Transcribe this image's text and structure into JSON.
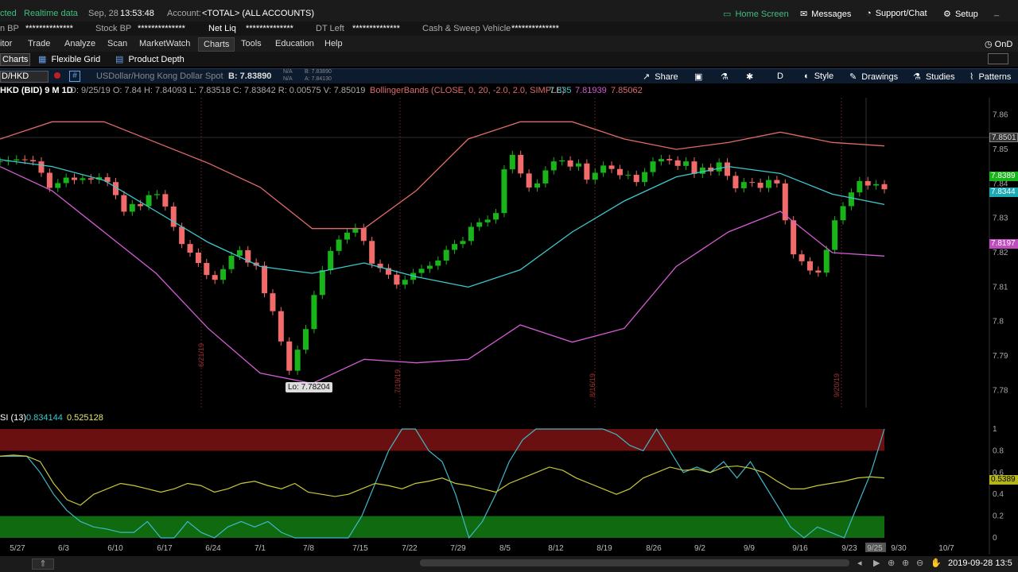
{
  "topbar": {
    "status_fragment": "cted",
    "realtime_label": "Realtime data",
    "date": "Sep, 28",
    "time": "13:53:48",
    "account_label": "Account:",
    "account_value": "<TOTAL> (ALL ACCOUNTS)",
    "home_screen": "Home Screen",
    "messages": "Messages",
    "support_chat": "Support/Chat",
    "setup": "Setup"
  },
  "acctbar": {
    "items": [
      {
        "label": "n BP",
        "value": "**************"
      },
      {
        "label": "Stock BP",
        "value": "**************"
      },
      {
        "label": "Net Liq",
        "value": "**************"
      },
      {
        "label": "DT Left",
        "value": "**************"
      },
      {
        "label": "Cash & Sweep Vehicle",
        "value": "**************"
      }
    ]
  },
  "menu": {
    "items": [
      "itor",
      "Trade",
      "Analyze",
      "Scan",
      "MarketWatch",
      "Charts",
      "Tools",
      "Education",
      "Help"
    ],
    "active": "Charts",
    "right_item": "OnD"
  },
  "subbar": {
    "charts_tab": "Charts",
    "flexible_grid": "Flexible Grid",
    "product_depth": "Product Depth"
  },
  "chart_header": {
    "symbol": "D/HKD",
    "description": "USDollar/Hong Kong Dollar Spot",
    "bid": "B: 7.83890",
    "na1": "N/A",
    "na2": "N/A",
    "b_small": "B: 7.83890",
    "a_small": "A: 7.84130",
    "share": "Share",
    "aggregation": "D",
    "style": "Style",
    "drawings": "Drawings",
    "studies": "Studies",
    "patterns": "Patterns"
  },
  "study_bar": {
    "title": "HKD (BID) 9 M 1D",
    "ohlc": "D: 9/25/19  O: 7.84  H: 7.84093  L: 7.83518  C: 7.83842  R: 0.00575  V: 7.85019",
    "bb_label": "BollingerBands (CLOSE, 0, 20, -2.0, 2.0, SIMPLE)",
    "bb_mid": "7.835",
    "bb_low": "7.81939",
    "bb_up": "7.85062"
  },
  "lower_study": {
    "title": "SI (13)",
    "v1": "0.834144",
    "v2": "0.525128"
  },
  "low_marker": "Lo: 7.78204",
  "price_boxes": {
    "top": "7.8501",
    "last": "7.8389",
    "mid": "7.8344",
    "low": "7.8197",
    "osc": "0.5389"
  },
  "vertical_dates": [
    "6/21/19",
    "7/19/19",
    "8/16/19",
    "9/20/19"
  ],
  "datetime_footer": "2019-09-28 13:5",
  "colors": {
    "up": "#19b419",
    "down": "#f26b6b",
    "bb_upper": "#e06a6a",
    "bb_mid": "#3ec8d0",
    "bb_lower": "#d35cd3",
    "osc_fast": "#3fb8c8",
    "osc_slow": "#c8c83a",
    "ob_zone": "#6a1010",
    "os_zone": "#106a10"
  },
  "chart_data": [
    {
      "type": "candlestick",
      "title": "USDollar/Hong Kong Dollar Spot",
      "x_ticks": [
        "5/27",
        "6/3",
        "6/10",
        "6/17",
        "6/24",
        "7/1",
        "7/8",
        "7/15",
        "7/22",
        "7/29",
        "8/5",
        "8/12",
        "8/19",
        "8/26",
        "9/2",
        "9/9",
        "9/16",
        "9/23",
        "9/25",
        "9/30",
        "10/7"
      ],
      "y_ticks": [
        7.86,
        7.85,
        7.84,
        7.83,
        7.82,
        7.81,
        7.8,
        7.79,
        7.78
      ],
      "ylim": [
        7.775,
        7.865
      ],
      "close": [
        7.8465,
        7.8468,
        7.8471,
        7.8469,
        7.8465,
        7.8432,
        7.8388,
        7.8402,
        7.8418,
        7.8411,
        7.8416,
        7.8412,
        7.8419,
        7.8405,
        7.8367,
        7.8319,
        7.8341,
        7.8335,
        7.8367,
        7.837,
        7.8334,
        7.8275,
        7.8225,
        7.82,
        7.817,
        7.8135,
        7.8121,
        7.8152,
        7.8191,
        7.8207,
        7.8171,
        7.8162,
        7.8082,
        7.803,
        7.7942,
        7.7857,
        7.7918,
        7.7978,
        7.8077,
        7.8149,
        7.8205,
        7.8238,
        7.8258,
        7.8272,
        7.8234,
        7.8168,
        7.8155,
        7.8136,
        7.8107,
        7.8121,
        7.8141,
        7.8153,
        7.8162,
        7.8177,
        7.8208,
        7.8225,
        7.8234,
        7.8275,
        7.8288,
        7.8296,
        7.8315,
        7.8442,
        7.8484,
        7.843,
        7.8389,
        7.8401,
        7.8439,
        7.8465,
        7.8468,
        7.845,
        7.8459,
        7.8412,
        7.8432,
        7.8453,
        7.8443,
        7.8425,
        7.8426,
        7.8405,
        7.8434,
        7.8465,
        7.8472,
        7.8468,
        7.8452,
        7.8465,
        7.8429,
        7.8447,
        7.8436,
        7.8462,
        7.8423,
        7.8387,
        7.8405,
        7.8403,
        7.8388,
        7.8411,
        7.8401,
        7.8294,
        7.8195,
        7.8175,
        7.8148,
        7.8142,
        7.8208,
        7.8294,
        7.8335,
        7.8375,
        7.8408,
        7.8395,
        7.8399,
        7.8384
      ],
      "bollinger": {
        "upper_approx": [
          7.853,
          7.858,
          7.858,
          7.852,
          7.846,
          7.839,
          7.827,
          7.827,
          7.838,
          7.853,
          7.858,
          7.858,
          7.853,
          7.85,
          7.852,
          7.855,
          7.852,
          7.851
        ],
        "middle_approx": [
          7.847,
          7.845,
          7.841,
          7.832,
          7.823,
          7.816,
          7.814,
          7.817,
          7.813,
          7.81,
          7.815,
          7.826,
          7.835,
          7.842,
          7.845,
          7.843,
          7.837,
          7.834
        ],
        "lower_approx": [
          7.845,
          7.838,
          7.826,
          7.814,
          7.798,
          7.785,
          7.782,
          7.789,
          7.788,
          7.789,
          7.799,
          7.794,
          7.798,
          7.816,
          7.826,
          7.832,
          7.82,
          7.819
        ]
      },
      "low": 7.78204
    },
    {
      "type": "line",
      "title": "SI (13)",
      "y_ticks": [
        1,
        0.8,
        0.6,
        0.4,
        0.2,
        0
      ],
      "ylim": [
        0,
        1
      ],
      "series": [
        {
          "name": "SI fast",
          "values": [
            0.75,
            0.75,
            0.75,
            0.6,
            0.4,
            0.25,
            0.15,
            0.1,
            0.08,
            0.05,
            0.05,
            0.15,
            0.0,
            0.0,
            0.15,
            0.05,
            0.0,
            0.1,
            0.15,
            0.1,
            0.15,
            0.05,
            0.0,
            0.0,
            0.0,
            0.0,
            0.0,
            0.2,
            0.5,
            0.8,
            1.0,
            1.0,
            0.8,
            0.7,
            0.4,
            0.0,
            0.15,
            0.4,
            0.7,
            0.9,
            1.0,
            1.0,
            1.0,
            1.0,
            1.0,
            1.0,
            0.95,
            0.85,
            0.8,
            1.0,
            0.8,
            0.6,
            0.65,
            0.6,
            0.7,
            0.55,
            0.7,
            0.5,
            0.3,
            0.1,
            0.0,
            0.1,
            0.05,
            0.0,
            0.3,
            0.6,
            1.0
          ]
        },
        {
          "name": "SI slow",
          "values": [
            0.75,
            0.76,
            0.75,
            0.7,
            0.5,
            0.35,
            0.3,
            0.4,
            0.45,
            0.5,
            0.48,
            0.45,
            0.42,
            0.45,
            0.5,
            0.48,
            0.42,
            0.45,
            0.5,
            0.52,
            0.48,
            0.45,
            0.5,
            0.42,
            0.4,
            0.38,
            0.4,
            0.45,
            0.5,
            0.48,
            0.45,
            0.5,
            0.52,
            0.55,
            0.5,
            0.48,
            0.45,
            0.42,
            0.5,
            0.55,
            0.6,
            0.65,
            0.62,
            0.55,
            0.5,
            0.45,
            0.4,
            0.45,
            0.55,
            0.6,
            0.65,
            0.62,
            0.63,
            0.6,
            0.65,
            0.66,
            0.64,
            0.6,
            0.52,
            0.45,
            0.45,
            0.48,
            0.5,
            0.52,
            0.55,
            0.56,
            0.55
          ]
        }
      ],
      "bands": {
        "overbought": 0.8,
        "oversold": 0.2
      }
    }
  ]
}
